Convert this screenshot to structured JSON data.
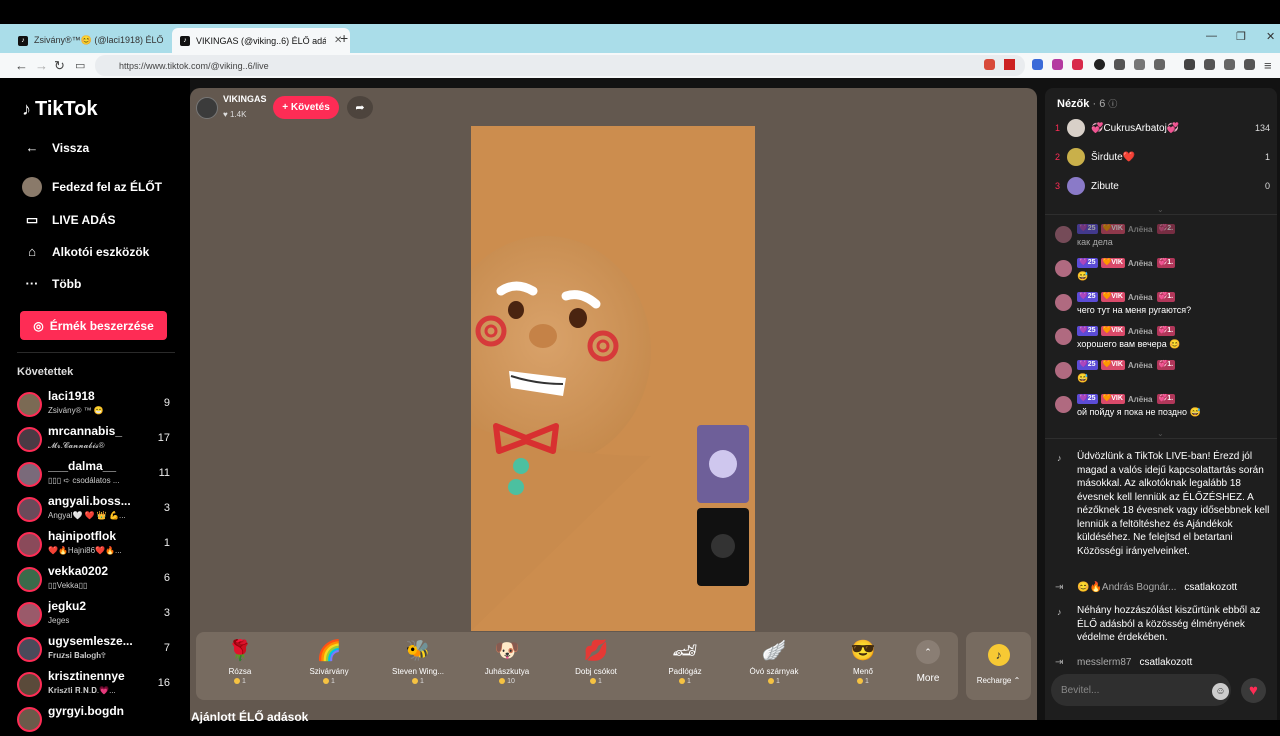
{
  "browser": {
    "tabs": [
      {
        "title": "Zsivány®™😊 (@laci1918) ÉLŐ adás",
        "icon": "tiktok-icon"
      },
      {
        "title": "VIKINGAS (@viking..6) ÉLŐ adás",
        "icon": "tiktok-icon"
      }
    ],
    "url": "https://www.tiktok.com/@viking..6/live"
  },
  "sidebar": {
    "logo": "TikTok",
    "nav": [
      {
        "label": "Vissza",
        "icon": "arrow-left-icon"
      },
      {
        "label": "Fedezd fel az ÉLŐT",
        "icon": "avatar-icon"
      },
      {
        "label": "LIVE ADÁS",
        "icon": "camera-icon"
      },
      {
        "label": "Alkotói eszközök",
        "icon": "house-plus-icon"
      },
      {
        "label": "Több",
        "icon": "more-dots-icon"
      }
    ],
    "coins_button": "Érmék beszerzése",
    "following_header": "Követettek",
    "following": [
      {
        "name": "laci1918",
        "sub": "Zsivány® ™ 😁",
        "count": "9",
        "color": "#7b6a54"
      },
      {
        "name": "mrcannabis_",
        "sub": "𝓜𝓻.𝓒𝓪𝓷𝓷𝓪𝓫𝓲𝓼®",
        "count": "17",
        "color": "#4a3a44"
      },
      {
        "name": "___dalma__",
        "sub": "▯▯▯ ➪ csodálatos ...",
        "count": "11",
        "color": "#7a6a7a"
      },
      {
        "name": "angyali.boss...",
        "sub": "Angyal🤍 ❤️ 👑 💪...",
        "count": "3",
        "color": "#6a4a5a"
      },
      {
        "name": "hajnipotflok",
        "sub": "❤️🔥Hajni86❤️🔥...",
        "count": "1",
        "color": "#8a4a5a"
      },
      {
        "name": "vekka0202",
        "sub": "▯▯Vekka▯▯",
        "count": "6",
        "color": "#3a6a4a"
      },
      {
        "name": "jegku2",
        "sub": "Jeges",
        "count": "3",
        "color": "#9a5a6a"
      },
      {
        "name": "ugysemlesze...",
        "sub": "𝐅𝐫𝐮𝐳𝐬𝐢 𝐁𝐚𝐥𝐨𝐠𝐡✞",
        "count": "7",
        "color": "#4a4a5a"
      },
      {
        "name": "krisztinennye",
        "sub": "𝐊𝐫𝐢𝐬𝐳𝐭𝐢 𝐑.𝐍.𝐃.💗...",
        "count": "16",
        "color": "#5a4a3a"
      },
      {
        "name": "gyrgyi.bogdn",
        "sub": "",
        "count": "",
        "color": "#6a5a4a"
      }
    ]
  },
  "stream": {
    "streamer_name": "VIKINGAS",
    "likes": "♥ 1.4K",
    "follow_button": "+ Követés",
    "gifts": [
      {
        "name": "Rózsa",
        "price": "1",
        "icon": "🌹"
      },
      {
        "name": "Szivárvány",
        "price": "1",
        "icon": "🌈"
      },
      {
        "name": "Steven Wing...",
        "price": "1",
        "icon": "🐝"
      },
      {
        "name": "Juhászkutya",
        "price": "10",
        "icon": "🐶"
      },
      {
        "name": "Dobj csókot",
        "price": "1",
        "icon": "💋"
      },
      {
        "name": "Padlógáz",
        "price": "1",
        "icon": "🏎"
      },
      {
        "name": "Óvó szárnyak",
        "price": "1",
        "icon": "🪽"
      },
      {
        "name": "Menő",
        "price": "1",
        "icon": "😎"
      }
    ],
    "more_label": "More",
    "recharge_label": "Recharge ⌃",
    "below_title": "Ajánlott ÉLŐ adások"
  },
  "panel": {
    "viewers_title": "Nézők",
    "viewers_count": "· 6",
    "viewers": [
      {
        "rank": "1",
        "name": "💞CukrusArbatoj💞",
        "value": "134",
        "color": "#d8d0c8"
      },
      {
        "rank": "2",
        "name": "Širdute❤️",
        "value": "1",
        "color": "#c9b04a"
      },
      {
        "rank": "3",
        "name": "Zibute",
        "value": "0",
        "color": "#8a7ac8"
      }
    ],
    "badge_level": "💜25",
    "badge_fan": "🧡VIK",
    "badge_heart": "💞1.",
    "badge_heart_first": "💞2.",
    "chat_user": "Алёна",
    "chat": [
      "как дела",
      "😅",
      "чего тут на меня ругаются?",
      "хорошего вам вечера 😊",
      "😅",
      "ой пойду я пока не поздно 😅"
    ],
    "welcome": "Üdvözlünk a TikTok LIVE-ban! Érezd jól magad a valós idejű kapcsolattartás során másokkal. Az alkotóknak legalább 18 évesnek kell lenniük az ÉLŐZÉSHEZ. A nézőknek 18 évesnek vagy idősebbnek kell lenniük a feltöltéshez és Ajándékok küldéséhez. Ne felejtsd el betartani Közösségi irányelveinket.",
    "joined1_user": "😊🔥András Bognár...",
    "joined1_text": "csatlakozott",
    "filtered": "Néhány hozzászólást kiszűrtünk ebből az ÉLŐ adásból a közösség élményének védelme érdekében.",
    "joined2_user": "messlerm87",
    "joined2_text": "csatlakozott",
    "input_placeholder": "Bevitel..."
  },
  "colors": {
    "accent": "#fe2c55",
    "stage": "#63584f",
    "video": "#cc8d4e"
  }
}
